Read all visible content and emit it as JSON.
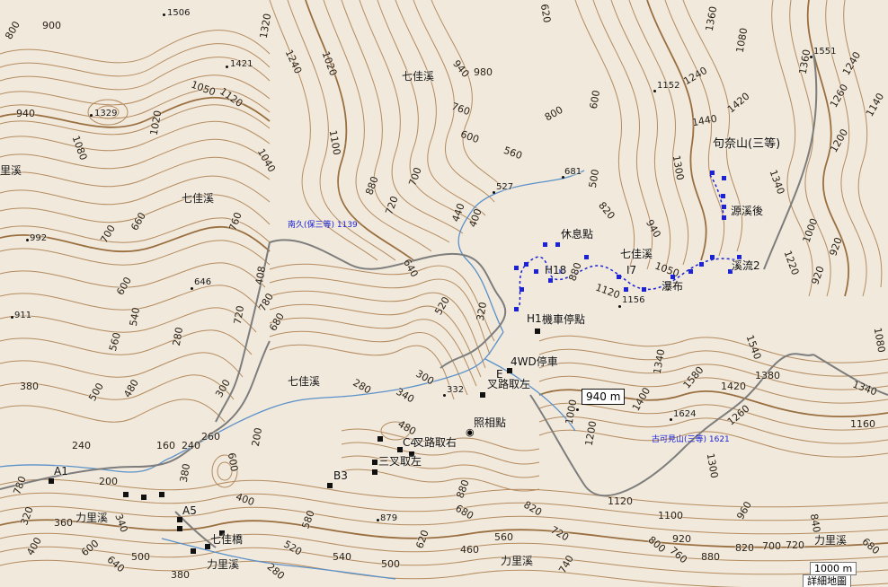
{
  "contour_intervals": {
    "minor": 20,
    "index": 100
  },
  "colors": {
    "background": "#f1e9dc",
    "contour": "#b48b5f",
    "contour_index": "#9a6f40",
    "river": "#5b91c9",
    "road": "#7d7d7d",
    "track": "#1b22d8",
    "waypoint": "#111111"
  },
  "elevation_box": "940 m",
  "scale": {
    "label": "1000 m",
    "link": "詳細地圖"
  },
  "camera_icon": "camera-icon",
  "streams": {
    "qijia_1": "七佳溪",
    "qijia_2": "七佳溪",
    "qijia_3": "七佳溪",
    "qijia_4": "七佳溪",
    "qijia_5": "七佳溪",
    "lili_1": "力里溪",
    "lili_2": "力里溪",
    "lili_3": "力里溪",
    "lili_4": "力里溪",
    "li_left": "里溪"
  },
  "peaks": {
    "nanjiuyuan": "南久(保三等) 1139",
    "gukejian": "古可見山(三等) 1621",
    "gunaishan": "句奈山(三等)"
  },
  "waypoints": {
    "rest": "休息點",
    "h18": "H18",
    "i7": "I7",
    "qijia_stream": "七佳溪",
    "waterfall": "瀑布",
    "source_after": "源溪後",
    "stream2": "溪流2",
    "h1": "H1",
    "moto_parking": "機車停點",
    "parking_4wd": "4WD停車",
    "e": "E",
    "fork_left_1": "叉路取左",
    "photo_spot": "照相點",
    "c4": "C4",
    "fork_right": "叉路取右",
    "fork_left_2": "三叉取左",
    "a1": "A1",
    "a5": "A5",
    "b3": "B3",
    "bridge": "七佳橋"
  },
  "spot_heights": {
    "s1506": "1506",
    "s1421": "1421",
    "s1329": "1329",
    "s992": "992",
    "s911": "911",
    "s646": "646",
    "s527": "527",
    "s681": "681",
    "s1152": "1152",
    "s1551": "1551",
    "s1156": "1156",
    "s332": "332",
    "s1624": "1624",
    "s879": "879"
  },
  "contour_labels": {
    "c800a": "800",
    "c900a": "900",
    "c940a": "940",
    "c1080a": "1080",
    "c1020a": "1020",
    "c1050a": "1050",
    "c1120a": "1120",
    "c1240a": "1240",
    "c1020b": "1020",
    "c1320a": "1320",
    "c1100a": "1100",
    "c1040a": "1040",
    "c880a": "880",
    "c720a": "720",
    "c700a": "700",
    "c760a": "760",
    "c700b": "700",
    "c660a": "660",
    "c600a": "600",
    "c560a": "560",
    "c540a": "540",
    "c280a": "280",
    "c500a": "500",
    "c480a": "480",
    "c380a": "380",
    "c720b": "720",
    "c680a": "680",
    "c780a": "780",
    "c408a": "408",
    "c640a": "640",
    "c520a": "520",
    "c320a": "320",
    "c440a": "440",
    "c400a": "400",
    "c940b": "940",
    "c980a": "980",
    "c760b": "760",
    "c600b": "600",
    "c560b": "560",
    "c800b": "800",
    "c600c": "600",
    "c620a": "620",
    "c500b": "500",
    "c820a": "820",
    "c880b": "880",
    "c1120b": "1120",
    "c1050b": "1050",
    "c1340a": "1340",
    "c1400a": "1400",
    "c1200a": "1200",
    "c1000a": "1000",
    "c940c": "940",
    "c1240b": "1240",
    "c1440a": "1440",
    "c1420a": "1420",
    "c1300a": "1300",
    "c1340b": "1340",
    "c1220a": "1220",
    "c1380a": "1380",
    "c1580a": "1580",
    "c1540a": "1540",
    "c1420b": "1420",
    "c1260a": "1260",
    "c1160a": "1160",
    "c1360a": "1360",
    "c1240c": "1240",
    "c1260b": "1260",
    "c1140a": "1140",
    "c1200b": "1200",
    "c920a": "920",
    "c1080b": "1080",
    "c920b": "920",
    "c1000b": "1000",
    "c1080c": "1080",
    "c1360b": "1360",
    "c1340c": "1340",
    "c1300b": "1300",
    "c960a": "960",
    "c840a": "840",
    "c1120c": "1120",
    "c1100b": "1100",
    "c920c": "920",
    "c880c": "880",
    "c820b": "820",
    "c760c": "760",
    "c800c": "800",
    "c700c": "700",
    "c720c": "720",
    "c680b": "680",
    "c880d": "880",
    "c560c": "560",
    "c460a": "460",
    "c620b": "620",
    "c580a": "580",
    "c520b": "520",
    "c540b": "540",
    "c500c": "500",
    "c600d": "600",
    "c640b": "640",
    "c500d": "500",
    "c400b": "400",
    "c380b": "380",
    "c340a": "340",
    "c360a": "360",
    "c320b": "320",
    "c400c": "400",
    "c280b": "280",
    "c300a": "300",
    "c340b": "340",
    "c480b": "480",
    "c240a": "240",
    "c160a": "160",
    "c240b": "240",
    "c260a": "260",
    "c200a": "200",
    "c780b": "780",
    "c1200c": "1200",
    "c1020c": "1020",
    "c1000c": "1000",
    "c940d": "940",
    "c700d": "700",
    "c740a": "740"
  }
}
